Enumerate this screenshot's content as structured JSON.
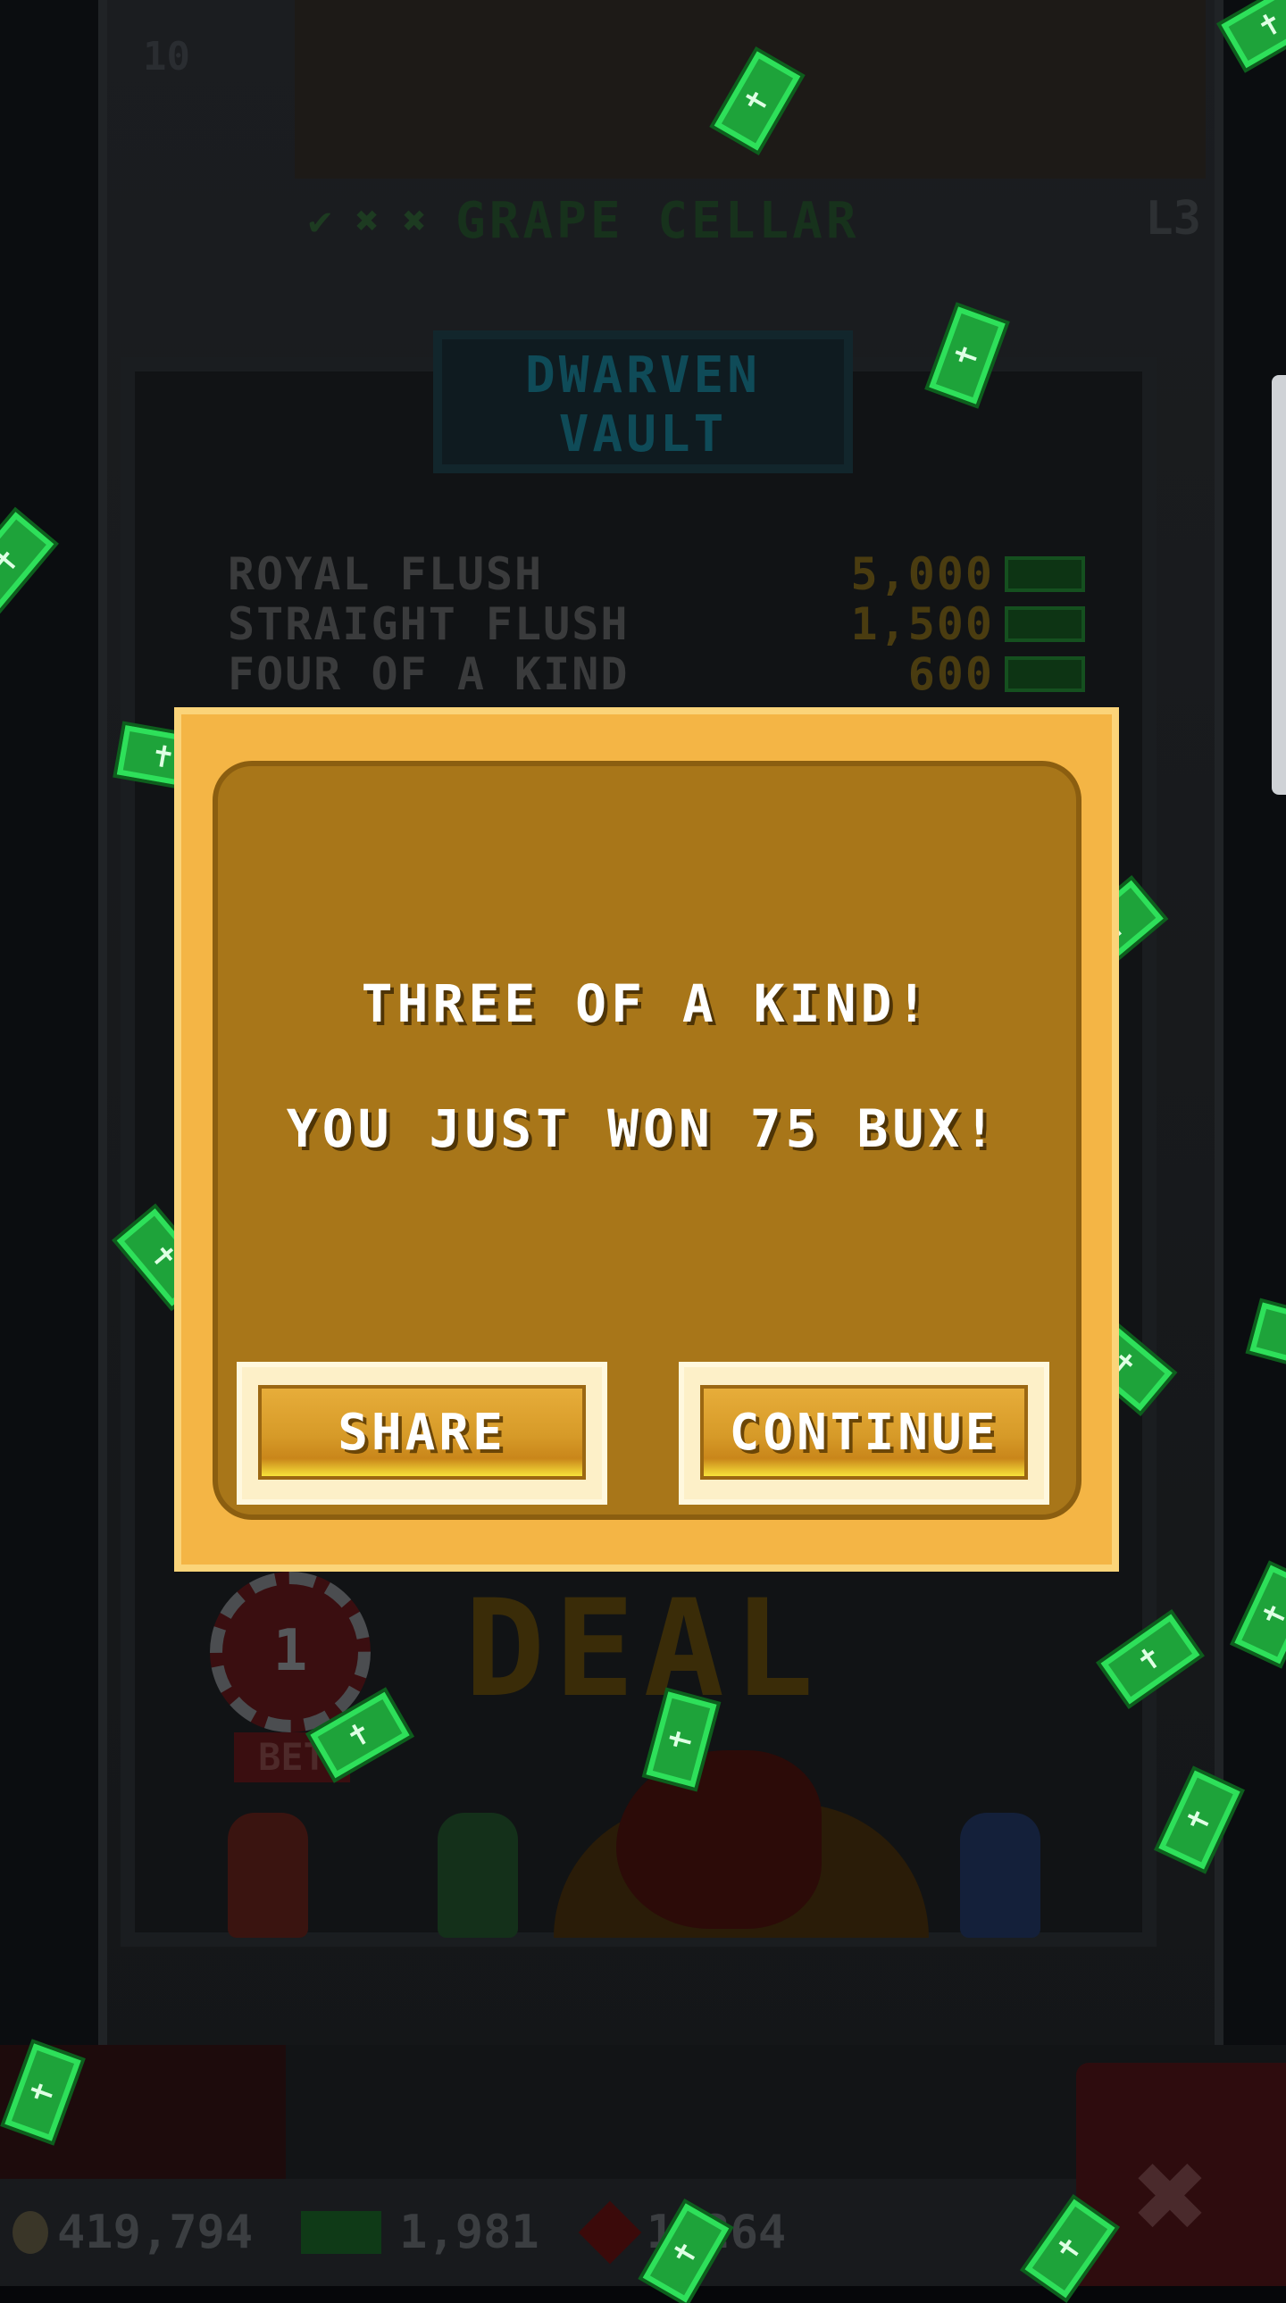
{
  "background": {
    "floor_number": "10",
    "floor_name": "GRAPE CELLAR",
    "floor_level": "L3",
    "vault_sign": "DWARVEN VAULT",
    "paytable": [
      {
        "hand": "ROYAL FLUSH",
        "payout": "5,000"
      },
      {
        "hand": "STRAIGHT FLUSH",
        "payout": "1,500"
      },
      {
        "hand": "FOUR OF A KIND",
        "payout": "600"
      }
    ],
    "deal_label": "DEAL",
    "bet_chip_value": "1",
    "bet_label": "BET"
  },
  "status_bar": {
    "coins": "419,794",
    "bux": "1,981",
    "gems": "1,264"
  },
  "dialog": {
    "title": "THREE OF A KIND!",
    "message": "YOU JUST WON 75 BUX!",
    "share_label": "SHARE",
    "continue_label": "CONTINUE"
  },
  "icons": {
    "close": "close-icon",
    "bill": "bux-bill-icon",
    "coin": "coin-icon",
    "gem": "gem-icon"
  },
  "colors": {
    "dialog_outer": "#f4b545",
    "dialog_inner": "#a87619",
    "bux_green": "#1ea33a"
  }
}
